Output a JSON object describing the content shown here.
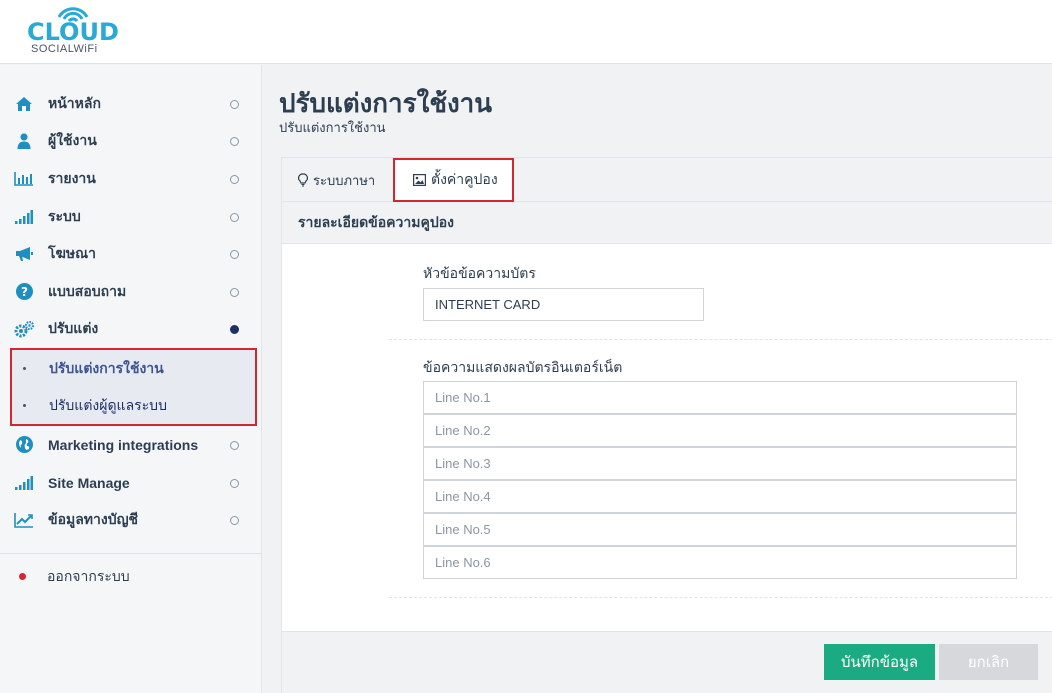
{
  "logo": {
    "main": "CLOUD",
    "sub": "SOCIALWiFi",
    "accent": "#29a9d6"
  },
  "sidebar": {
    "items": [
      {
        "label": "หน้าหลัก",
        "icon": "home-icon"
      },
      {
        "label": "ผู้ใช้งาน",
        "icon": "user-icon"
      },
      {
        "label": "รายงาน",
        "icon": "bar-chart-icon"
      },
      {
        "label": "ระบบ",
        "icon": "signal-icon"
      },
      {
        "label": "โฆษณา",
        "icon": "megaphone-icon"
      },
      {
        "label": "แบบสอบถาม",
        "icon": "question-icon"
      },
      {
        "label": "ปรับแต่ง",
        "icon": "gears-icon"
      }
    ],
    "submenu": [
      {
        "label": "ปรับแต่งการใช้งาน"
      },
      {
        "label": "ปรับแต่งผู้ดูแลระบบ"
      }
    ],
    "items_after": [
      {
        "label": "Marketing integrations",
        "icon": "globe-icon"
      },
      {
        "label": "Site Manage",
        "icon": "signal-icon"
      },
      {
        "label": "ข้อมูลทางบัญชี",
        "icon": "line-chart-icon"
      }
    ],
    "logout": "ออกจากระบบ"
  },
  "page": {
    "title": "ปรับแต่งการใช้งาน",
    "subtitle": "ปรับแต่งการใช้งาน"
  },
  "tabs": {
    "language": "ระบบภาษา",
    "coupon": "ตั้งค่าคูปอง"
  },
  "section": {
    "title": "รายละเอียดข้อความคูปอง"
  },
  "form": {
    "header_label": "หัวข้อข้อความบัตร",
    "header_value": "INTERNET CARD",
    "lines_label": "ข้อความแสดงผลบัตรอินเตอร์เน็ต",
    "lines": [
      "Line No.1",
      "Line No.2",
      "Line No.3",
      "Line No.4",
      "Line No.5",
      "Line No.6"
    ]
  },
  "buttons": {
    "save": "บันทึกข้อมูล",
    "cancel": "ยกเลิก"
  },
  "colors": {
    "save": "#1aab82",
    "highlight": "#d22630",
    "icon": "#1e8fc0"
  }
}
